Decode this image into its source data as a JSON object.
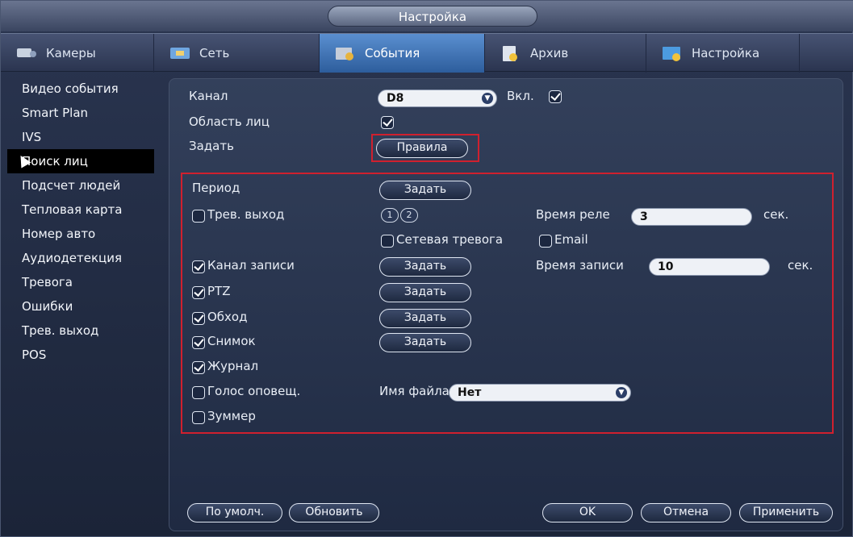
{
  "window": {
    "title": "Настройка"
  },
  "tabs": [
    {
      "label": "Камеры",
      "icon": "camera-icon"
    },
    {
      "label": "Сеть",
      "icon": "network-icon"
    },
    {
      "label": "События",
      "icon": "events-icon",
      "active": true
    },
    {
      "label": "Архив",
      "icon": "archive-icon"
    },
    {
      "label": "Настройка",
      "icon": "settings-icon"
    }
  ],
  "sidebar": {
    "items": [
      {
        "label": "Видео события"
      },
      {
        "label": "Smart Plan"
      },
      {
        "label": "IVS"
      },
      {
        "label": "Поиск лиц",
        "active": true
      },
      {
        "label": "Подсчет людей"
      },
      {
        "label": "Тепловая карта"
      },
      {
        "label": "Номер авто"
      },
      {
        "label": "Аудиодетекция"
      },
      {
        "label": "Тревога"
      },
      {
        "label": "Ошибки"
      },
      {
        "label": "Трев. выход"
      },
      {
        "label": "POS"
      }
    ]
  },
  "form": {
    "channel_label": "Канал",
    "channel_value": "D8",
    "enable_label": "Вкл.",
    "enable_checked": true,
    "face_area_label": "Область лиц",
    "face_area_checked": true,
    "set_label": "Задать",
    "rules_button": "Правила",
    "period_label": "Период",
    "period_button": "Задать",
    "alarm_out_label": "Трев. выход",
    "alarm_out_checked": false,
    "alarm_out_channels": [
      "1",
      "2"
    ],
    "relay_time_label": "Время реле",
    "relay_time_value": "3",
    "relay_time_unit": "сек.",
    "net_alarm_label": "Сетевая тревога",
    "net_alarm_checked": false,
    "email_label": "Email",
    "email_checked": false,
    "record_channel_label": "Канал записи",
    "record_channel_checked": true,
    "record_channel_button": "Задать",
    "record_time_label": "Время записи",
    "record_time_value": "10",
    "record_time_unit": "сек.",
    "ptz_label": "PTZ",
    "ptz_checked": true,
    "ptz_button": "Задать",
    "tour_label": "Обход",
    "tour_checked": true,
    "tour_button": "Задать",
    "snapshot_label": "Снимок",
    "snapshot_checked": true,
    "snapshot_button": "Задать",
    "log_label": "Журнал",
    "log_checked": true,
    "voice_label": "Голос оповещ.",
    "voice_checked": false,
    "filename_label": "Имя файла",
    "filename_value": "Нет",
    "buzzer_label": "Зуммер",
    "buzzer_checked": false
  },
  "footer": {
    "default_button": "По умолч.",
    "refresh_button": "Обновить",
    "ok_button": "OK",
    "cancel_button": "Отмена",
    "apply_button": "Применить"
  },
  "colors": {
    "active_tab": "#3f74b8",
    "highlight_box": "#d0202e"
  }
}
